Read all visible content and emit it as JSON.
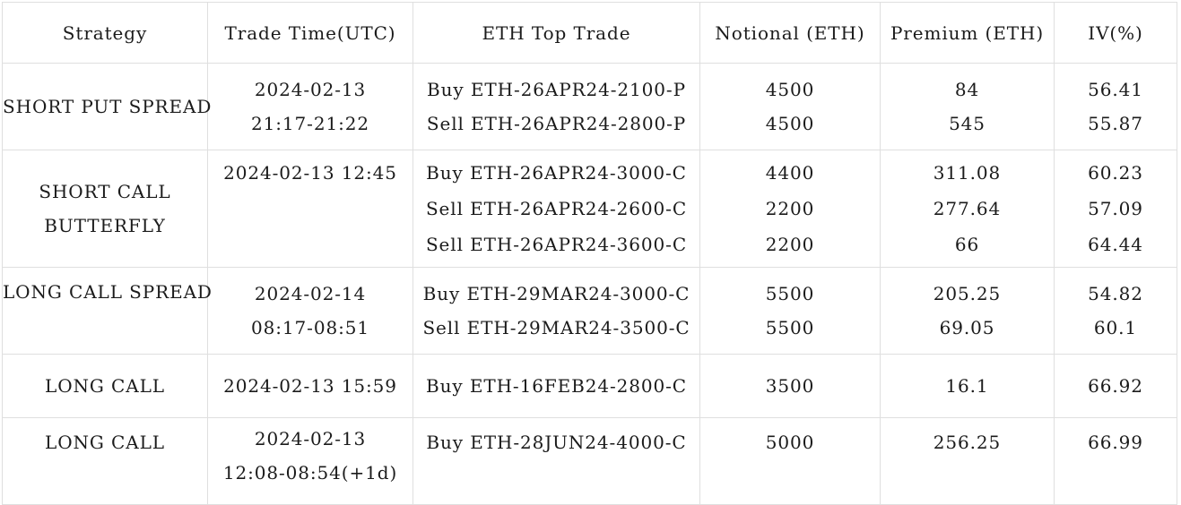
{
  "table": {
    "columns": [
      "Strategy",
      "Trade Time(UTC)",
      "ETH Top Trade",
      "Notional (ETH)",
      "Premium (ETH)",
      "IV(%)"
    ],
    "rows": [
      {
        "strategy": [
          "SHORT PUT SPREAD"
        ],
        "time": [
          "2024-02-13",
          "21:17-21:22"
        ],
        "trades": [
          "Buy ETH-26APR24-2100-P",
          "Sell ETH-26APR24-2800-P"
        ],
        "notional": [
          "4500",
          "4500"
        ],
        "premium": [
          "84",
          "545"
        ],
        "iv": [
          "56.41",
          "55.87"
        ]
      },
      {
        "strategy": [
          "SHORT CALL",
          "BUTTERFLY"
        ],
        "time": [
          "2024-02-13 12:45"
        ],
        "trades": [
          "Buy ETH-26APR24-3000-C",
          "Sell ETH-26APR24-2600-C",
          "Sell ETH-26APR24-3600-C"
        ],
        "notional": [
          "4400",
          "2200",
          "2200"
        ],
        "premium": [
          "311.08",
          "277.64",
          "66"
        ],
        "iv": [
          "60.23",
          "57.09",
          "64.44"
        ]
      },
      {
        "strategy": [
          "LONG CALL SPREAD"
        ],
        "time": [
          "2024-02-14",
          "08:17-08:51"
        ],
        "trades": [
          "Buy ETH-29MAR24-3000-C",
          "Sell ETH-29MAR24-3500-C"
        ],
        "notional": [
          "5500",
          "5500"
        ],
        "premium": [
          "205.25",
          "69.05"
        ],
        "iv": [
          "54.82",
          "60.1"
        ]
      },
      {
        "strategy": [
          "LONG CALL"
        ],
        "time": [
          "2024-02-13 15:59"
        ],
        "trades": [
          "Buy ETH-16FEB24-2800-C"
        ],
        "notional": [
          "3500"
        ],
        "premium": [
          "16.1"
        ],
        "iv": [
          "66.92"
        ]
      },
      {
        "strategy": [
          "LONG CALL"
        ],
        "time": [
          "2024-02-13",
          "12:08-08:54(+1d)"
        ],
        "trades": [
          "Buy ETH-28JUN24-4000-C"
        ],
        "notional": [
          "5000"
        ],
        "premium": [
          "256.25"
        ],
        "iv": [
          "66.99"
        ]
      }
    ]
  },
  "style": {
    "border_color": "#dfdfdf",
    "text_color": "#1b1b1b",
    "background": "#ffffff"
  }
}
